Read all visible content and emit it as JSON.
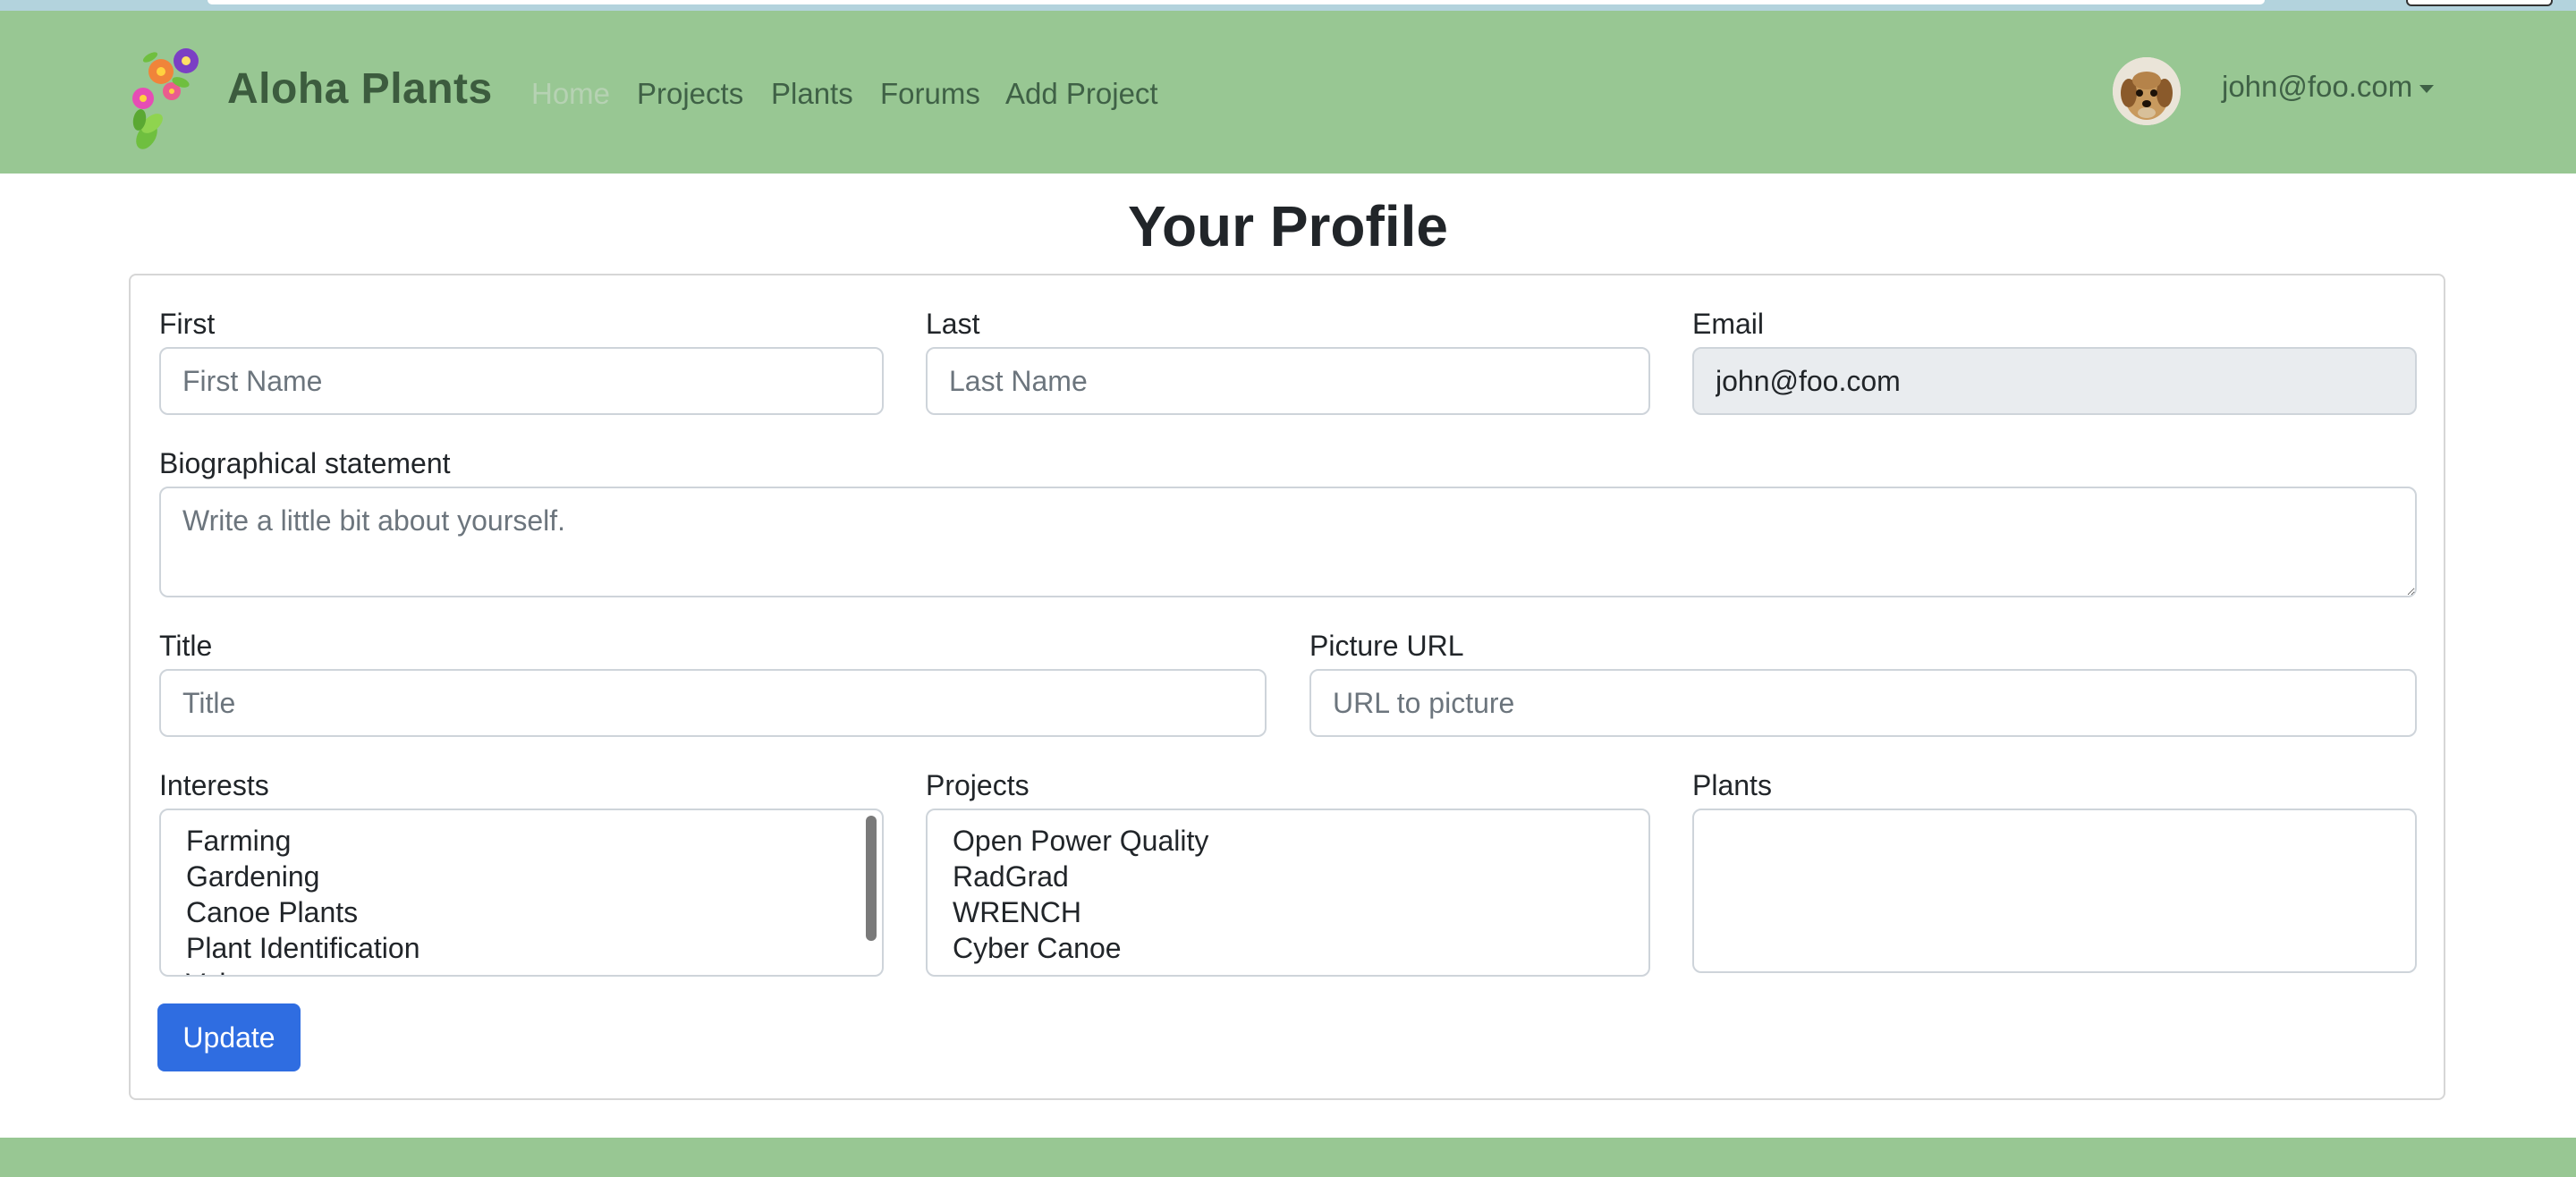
{
  "navbar": {
    "brand": "Aloha Plants",
    "links": [
      {
        "label": "Home",
        "active": true
      },
      {
        "label": "Projects",
        "active": false
      },
      {
        "label": "Plants",
        "active": false
      },
      {
        "label": "Forums",
        "active": false
      },
      {
        "label": "Add Project",
        "active": false
      }
    ],
    "user_email": "john@foo.com",
    "bg_color": "#98c793"
  },
  "page": {
    "title": "Your Profile"
  },
  "form": {
    "first": {
      "label": "First",
      "placeholder": "First Name",
      "value": ""
    },
    "last": {
      "label": "Last",
      "placeholder": "Last Name",
      "value": ""
    },
    "email": {
      "label": "Email",
      "value": "john@foo.com"
    },
    "bio": {
      "label": "Biographical statement",
      "placeholder": "Write a little bit about yourself."
    },
    "title": {
      "label": "Title",
      "placeholder": "Title"
    },
    "picture": {
      "label": "Picture URL",
      "placeholder": "URL to picture"
    },
    "interests": {
      "label": "Interests",
      "options": [
        "Farming",
        "Gardening",
        "Canoe Plants",
        "Plant Identification",
        "Volunteer"
      ]
    },
    "projects": {
      "label": "Projects",
      "options": [
        "Open Power Quality",
        "RadGrad",
        "WRENCH",
        "Cyber Canoe"
      ]
    },
    "plants": {
      "label": "Plants",
      "options": []
    },
    "submit_label": "Update"
  },
  "colors": {
    "primary_button": "#2f6de1",
    "navbar": "#98c793"
  }
}
